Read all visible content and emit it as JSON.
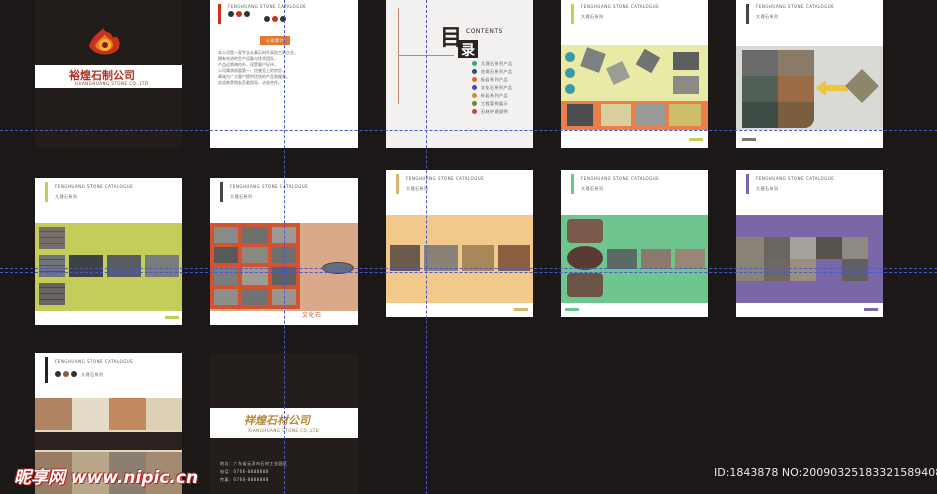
{
  "cover": {
    "company_name": "裕煌石制公司",
    "company_sub": "GUANGHUANG STONE CO.,LTD"
  },
  "back_cover": {
    "company_name": "祥煌石材公司",
    "company_sub": "XIANGHUANG STONE CO.,LTD",
    "contact_lines": [
      "地址：广东省云浮市石材工业园区",
      "电话：0766-8888888",
      "传真：0766-8888888"
    ]
  },
  "toc": {
    "big_char_1": "目",
    "big_char_2": "录",
    "heading": "CONTENTS",
    "items": [
      "大理石系列产品",
      "花岗石系列产品",
      "板岩系列产品",
      "文化石系列产品",
      "砂岩系列产品",
      "工程案例展示",
      "石材护理说明"
    ],
    "dot_colors": [
      "#3aa48a",
      "#2d4d7a",
      "#d9692b",
      "#4c4c8c",
      "#c6922f",
      "#5e8b3c",
      "#c8415f"
    ]
  },
  "catalog_header": "FENGHUANG STONE CATALOGUE",
  "series_label": "大理石系列",
  "intro": {
    "title": "公司简介",
    "lines": [
      "本公司是一家专业从事石材开采加工的企业，",
      "拥有先进的生产设备与技术团队，",
      "产品远销海内外，深受客户好评。",
      "公司秉承质量第一、信誉至上的宗旨，",
      "竭诚为广大客户提供优质的产品和服务。",
      "欢迎各界朋友莅临指导，洽谈合作。"
    ]
  },
  "culture_stone_label": "文化石",
  "watermark": {
    "site": "昵享网 www.nipic.cn",
    "id_text": "ID:1843878 NO:20090325183321589408"
  },
  "colors": {
    "background": "#1b1817",
    "guide": "#4b56c8",
    "lime_band": "#c5cd5a",
    "orange_band": "#e9804a",
    "tan_band": "#f1c98a",
    "green_band": "#6fc58e",
    "purple_band": "#7a67a8",
    "pale_yellow": "#e8eaa6",
    "red_frame": "#d2532d"
  }
}
